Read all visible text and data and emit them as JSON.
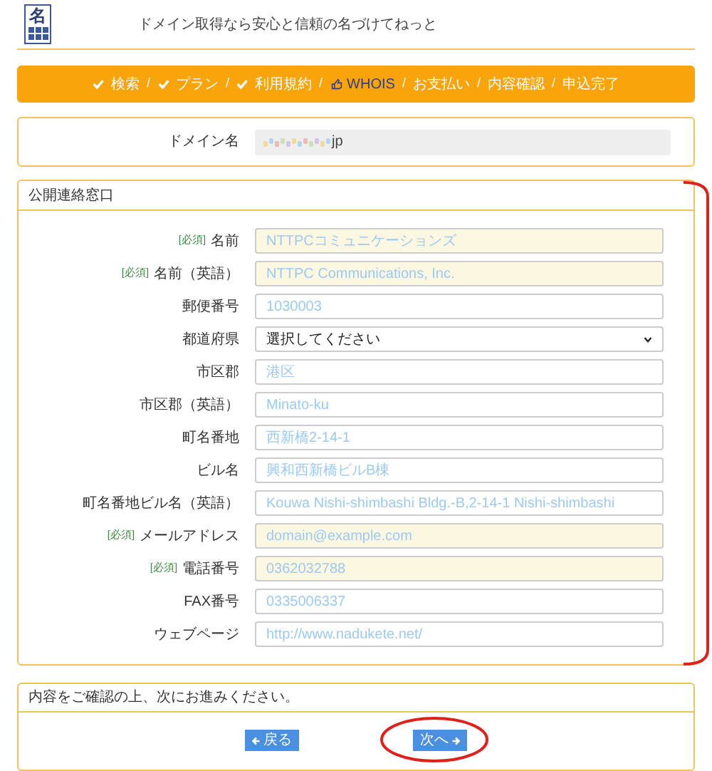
{
  "header": {
    "logo_text": "名",
    "tagline": "ドメイン取得なら安心と信頼の名づけてねっと"
  },
  "steps": [
    {
      "kind": "step",
      "label": "検索",
      "done": true,
      "selected": false
    },
    {
      "kind": "separator",
      "label": "/"
    },
    {
      "kind": "step",
      "label": "プラン",
      "done": true,
      "selected": false
    },
    {
      "kind": "separator",
      "label": "/"
    },
    {
      "kind": "step",
      "label": "利用規約",
      "done": true,
      "selected": false
    },
    {
      "kind": "separator",
      "label": "/"
    },
    {
      "kind": "step",
      "label": "WHOIS",
      "done": false,
      "selected": true
    },
    {
      "kind": "separator",
      "label": "/"
    },
    {
      "kind": "step",
      "label": "お支払い",
      "done": false,
      "selected": false
    },
    {
      "kind": "separator",
      "label": "/"
    },
    {
      "kind": "step",
      "label": "内容確認",
      "done": false,
      "selected": false
    },
    {
      "kind": "separator",
      "label": "/"
    },
    {
      "kind": "step",
      "label": "申込完了",
      "done": false,
      "selected": false
    }
  ],
  "domain": {
    "label": "ドメイン名",
    "value": "jp"
  },
  "contact": {
    "title": "公開連絡窓口",
    "fields": [
      {
        "kind": "input",
        "label": "名前",
        "required": true,
        "required_tag": "[必須]",
        "placeholder": "NTTPCコミュニケーションズ"
      },
      {
        "kind": "input",
        "label": "名前（英語）",
        "required": true,
        "required_tag": "[必須]",
        "placeholder": "NTTPC Communications, Inc."
      },
      {
        "kind": "input",
        "label": "郵便番号",
        "required": false,
        "placeholder": "1030003"
      },
      {
        "kind": "select",
        "label": "都道府県",
        "required": false,
        "value": "選択してください"
      },
      {
        "kind": "input",
        "label": "市区郡",
        "required": false,
        "placeholder": "港区"
      },
      {
        "kind": "input",
        "label": "市区郡（英語）",
        "required": false,
        "placeholder": "Minato-ku"
      },
      {
        "kind": "input",
        "label": "町名番地",
        "required": false,
        "placeholder": "西新橋2-14-1"
      },
      {
        "kind": "input",
        "label": "ビル名",
        "required": false,
        "placeholder": "興和西新橋ビルB棟"
      },
      {
        "kind": "input",
        "label": "町名番地ビル名（英語）",
        "required": false,
        "placeholder": "Kouwa Nishi-shimbashi Bldg.-B,2-14-1 Nishi-shimbashi"
      },
      {
        "kind": "input",
        "label": "メールアドレス",
        "required": true,
        "required_tag": "[必須]",
        "placeholder": "domain@example.com"
      },
      {
        "kind": "input",
        "label": "電話番号",
        "required": true,
        "required_tag": "[必須]",
        "placeholder": "0362032788"
      },
      {
        "kind": "input",
        "label": "FAX番号",
        "required": false,
        "placeholder": "0335006337"
      },
      {
        "kind": "input",
        "label": "ウェブページ",
        "required": false,
        "placeholder": "http://www.nadukete.net/"
      }
    ]
  },
  "confirm": {
    "message": "内容をご確認の上、次にお進みください。",
    "buttons": [
      {
        "label": "戻る",
        "kind": "back",
        "highlighted": false
      },
      {
        "label": "次へ",
        "kind": "next",
        "highlighted": true
      }
    ]
  }
}
